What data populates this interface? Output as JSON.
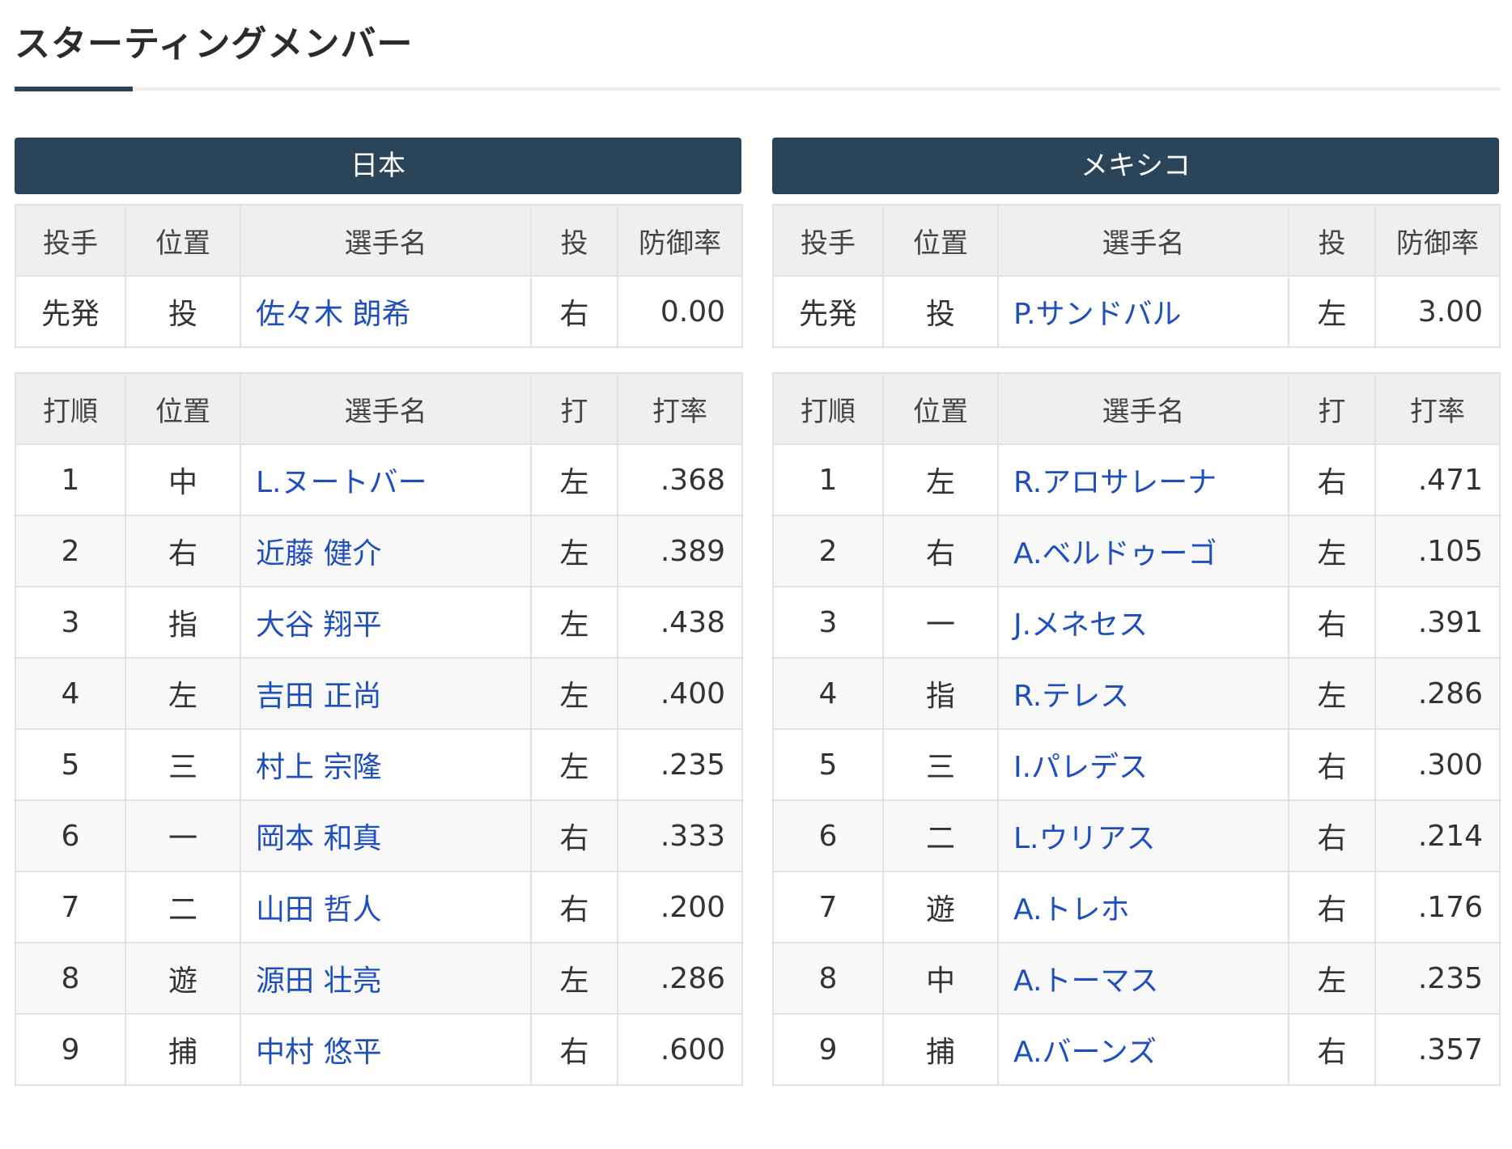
{
  "title": "スターティングメンバー",
  "pitcher_headers": [
    "投手",
    "位置",
    "選手名",
    "投",
    "防御率"
  ],
  "batter_headers": [
    "打順",
    "位置",
    "選手名",
    "打",
    "打率"
  ],
  "teams": [
    {
      "name": "日本",
      "pitcher": {
        "role": "先発",
        "pos": "投",
        "name": "佐々木 朗希",
        "throws": "右",
        "era": "0.00"
      },
      "lineup": [
        {
          "order": "1",
          "pos": "中",
          "name": "L.ヌートバー",
          "bats": "左",
          "avg": ".368"
        },
        {
          "order": "2",
          "pos": "右",
          "name": "近藤 健介",
          "bats": "左",
          "avg": ".389"
        },
        {
          "order": "3",
          "pos": "指",
          "name": "大谷 翔平",
          "bats": "左",
          "avg": ".438"
        },
        {
          "order": "4",
          "pos": "左",
          "name": "吉田 正尚",
          "bats": "左",
          "avg": ".400"
        },
        {
          "order": "5",
          "pos": "三",
          "name": "村上 宗隆",
          "bats": "左",
          "avg": ".235"
        },
        {
          "order": "6",
          "pos": "一",
          "name": "岡本 和真",
          "bats": "右",
          "avg": ".333"
        },
        {
          "order": "7",
          "pos": "二",
          "name": "山田 哲人",
          "bats": "右",
          "avg": ".200"
        },
        {
          "order": "8",
          "pos": "遊",
          "name": "源田 壮亮",
          "bats": "左",
          "avg": ".286"
        },
        {
          "order": "9",
          "pos": "捕",
          "name": "中村 悠平",
          "bats": "右",
          "avg": ".600"
        }
      ]
    },
    {
      "name": "メキシコ",
      "pitcher": {
        "role": "先発",
        "pos": "投",
        "name": "P.サンドバル",
        "throws": "左",
        "era": "3.00"
      },
      "lineup": [
        {
          "order": "1",
          "pos": "左",
          "name": "R.アロサレーナ",
          "bats": "右",
          "avg": ".471"
        },
        {
          "order": "2",
          "pos": "右",
          "name": "A.ベルドゥーゴ",
          "bats": "左",
          "avg": ".105"
        },
        {
          "order": "3",
          "pos": "一",
          "name": "J.メネセス",
          "bats": "右",
          "avg": ".391"
        },
        {
          "order": "4",
          "pos": "指",
          "name": "R.テレス",
          "bats": "左",
          "avg": ".286"
        },
        {
          "order": "5",
          "pos": "三",
          "name": "I.パレデス",
          "bats": "右",
          "avg": ".300"
        },
        {
          "order": "6",
          "pos": "二",
          "name": "L.ウリアス",
          "bats": "右",
          "avg": ".214"
        },
        {
          "order": "7",
          "pos": "遊",
          "name": "A.トレホ",
          "bats": "右",
          "avg": ".176"
        },
        {
          "order": "8",
          "pos": "中",
          "name": "A.トーマス",
          "bats": "左",
          "avg": ".235"
        },
        {
          "order": "9",
          "pos": "捕",
          "name": "A.バーンズ",
          "bats": "右",
          "avg": ".357"
        }
      ]
    }
  ]
}
